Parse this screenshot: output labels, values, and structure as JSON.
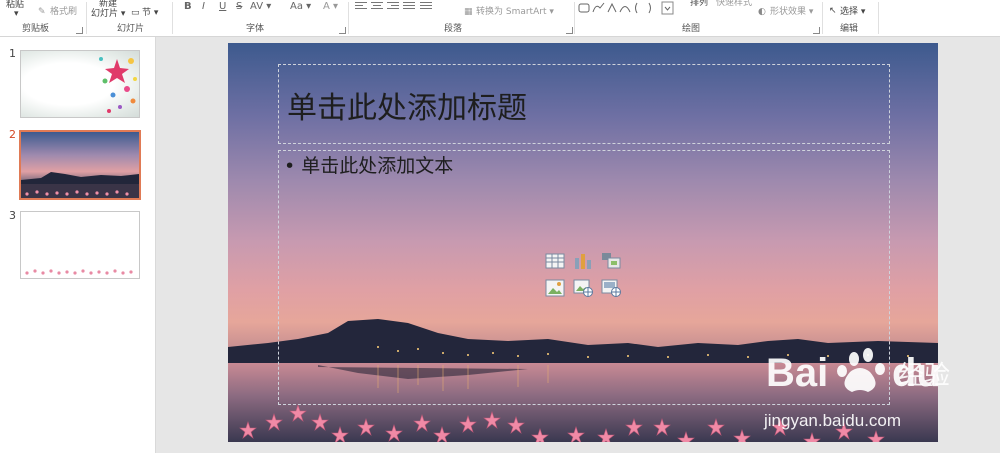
{
  "ribbon": {
    "clipboard": {
      "paste": "粘贴",
      "format_painter": "格式刷",
      "label": "剪贴板"
    },
    "slides": {
      "new_slide_line1": "新建",
      "new_slide_line2": "幻灯片 ▾",
      "section": "节 ▾",
      "label": "幻灯片"
    },
    "font": {
      "bold": "B",
      "italic": "I",
      "underline": "U",
      "strike": "S",
      "spacing": "AV ▾",
      "case": "Aa ▾",
      "color": "A ▾",
      "label": "字体"
    },
    "paragraph": {
      "smartart": "转换为 SmartArt ▾",
      "label": "段落"
    },
    "drawing": {
      "arrange": "排列",
      "quick_styles": "快速样式",
      "shape_effects": "形状效果 ▾",
      "label": "绘图"
    },
    "editing": {
      "select": "选择 ▾",
      "label": "编辑"
    }
  },
  "thumbnails": [
    {
      "number": "1"
    },
    {
      "number": "2"
    },
    {
      "number": "3"
    }
  ],
  "slide": {
    "title_placeholder": "单击此处添加标题",
    "body_placeholder": "• 单击此处添加文本"
  },
  "watermark": {
    "brand": "Bai",
    "brand2": "du",
    "cn": "经验",
    "url": "jingyan.baidu.com"
  }
}
